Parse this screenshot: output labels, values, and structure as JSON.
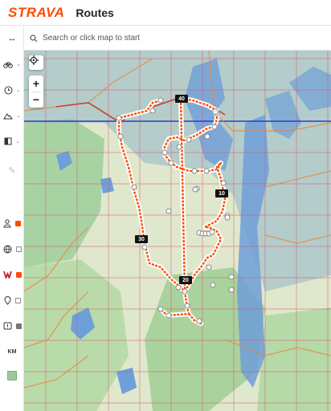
{
  "header": {
    "logo": "STRAVA",
    "title": "Routes"
  },
  "search": {
    "placeholder": "Search or click map to start"
  },
  "sidebar": {
    "items": [
      {
        "icon": "expand-arrows-icon"
      },
      {
        "icon": "bike-icon"
      },
      {
        "icon": "clock-icon"
      },
      {
        "icon": "elevation-icon"
      },
      {
        "icon": "surface-icon"
      },
      {
        "icon": "pencil-icon"
      },
      {
        "icon": "person-icon",
        "checked": true
      },
      {
        "icon": "globe-icon",
        "checked": false
      },
      {
        "icon": "heatmap-icon",
        "checked": true
      },
      {
        "icon": "pin-icon",
        "checked": false
      },
      {
        "icon": "poi-icon",
        "checked": true
      },
      {
        "icon": "units-icon",
        "label": "KM"
      },
      {
        "icon": "terrain-map-icon"
      }
    ]
  },
  "map": {
    "zoom_in": "+",
    "zoom_out": "−",
    "markers": [
      "40",
      "10",
      "30",
      "20"
    ],
    "colors": {
      "route": "#fc4c02",
      "grid": "#d9546e",
      "water": "#6f9fd8",
      "forest": "#9cc99a"
    }
  }
}
